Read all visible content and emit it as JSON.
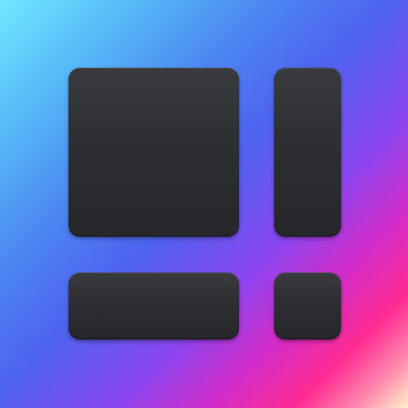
{
  "app_icon": {
    "name": "dashboard-layout-icon",
    "background_gradient": [
      "#6fe8ff",
      "#4f63f0",
      "#8b46f0",
      "#ff2b91",
      "#fff3c8"
    ],
    "tile_color": "#2d2e32",
    "tiles": [
      {
        "name": "dashboard-tile-large-icon"
      },
      {
        "name": "dashboard-tile-tall-icon"
      },
      {
        "name": "dashboard-tile-wide-icon"
      },
      {
        "name": "dashboard-tile-small-icon"
      }
    ]
  }
}
